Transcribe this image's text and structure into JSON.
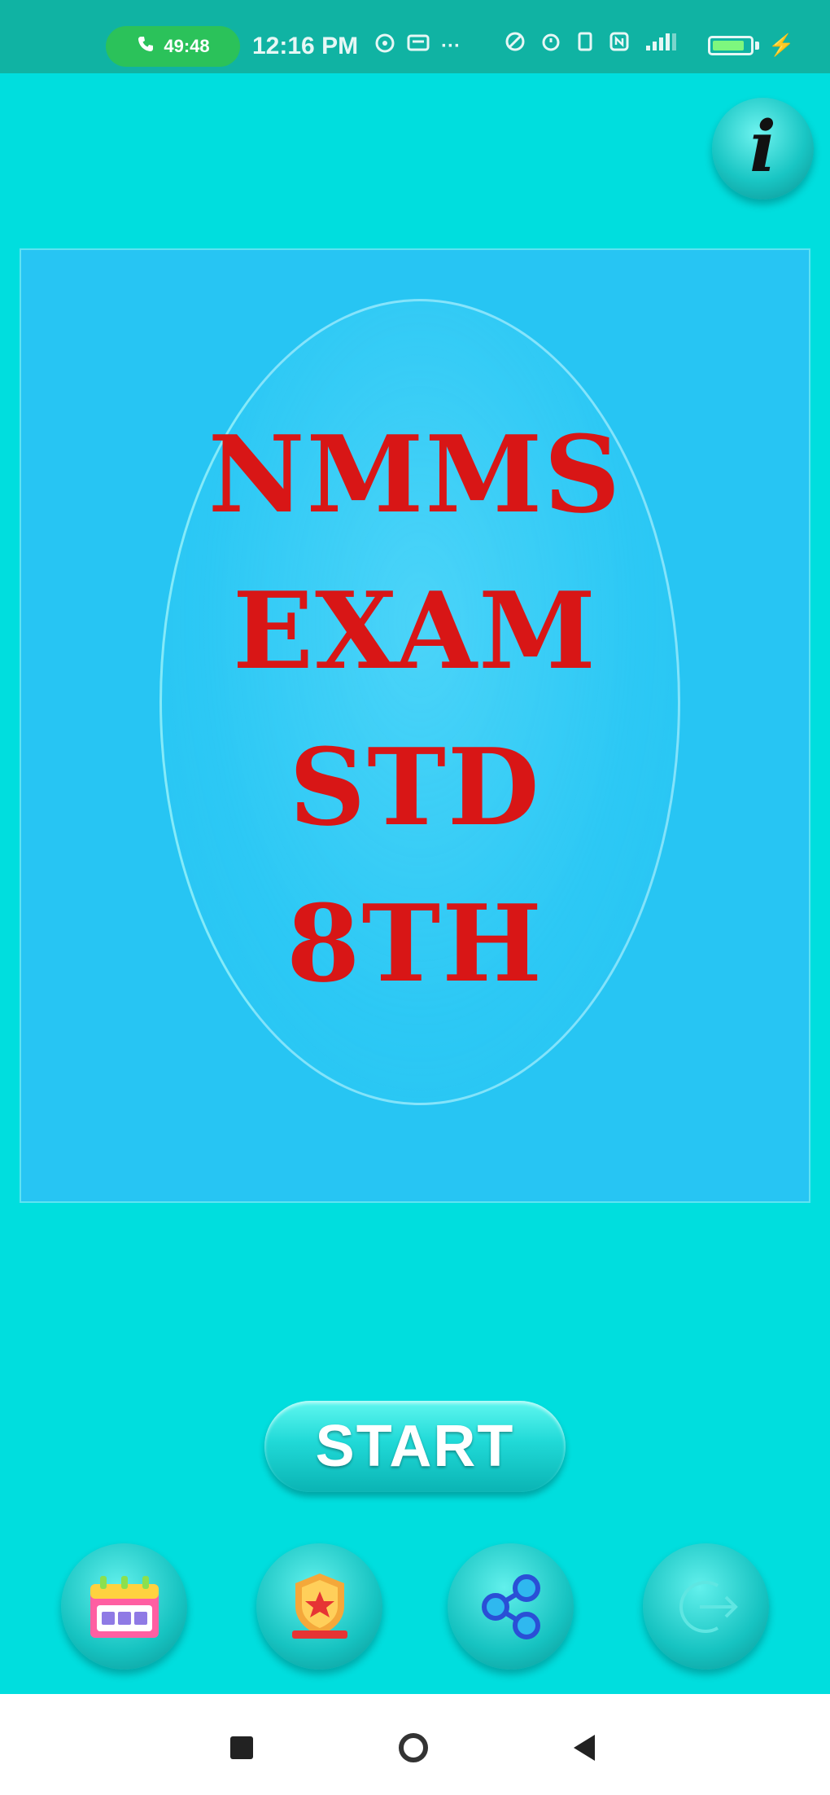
{
  "status_bar": {
    "call_label": "49:48",
    "time": "12:16 PM",
    "overflow": "···"
  },
  "title": {
    "lines": [
      "NMMS",
      "EXAM",
      "STD",
      "8TH"
    ]
  },
  "start_button": {
    "label": "START"
  },
  "colors": {
    "background": "#00dede",
    "panel": "#27c5f3",
    "title_text": "#d81616",
    "status_bar": "#10b3a3"
  },
  "icons": {
    "info": "info-icon",
    "bottom": [
      "calendar-icon",
      "award-badge-icon",
      "share-icon",
      "exit-icon"
    ],
    "nav": [
      "recents-square-icon",
      "home-circle-icon",
      "back-triangle-icon"
    ]
  }
}
